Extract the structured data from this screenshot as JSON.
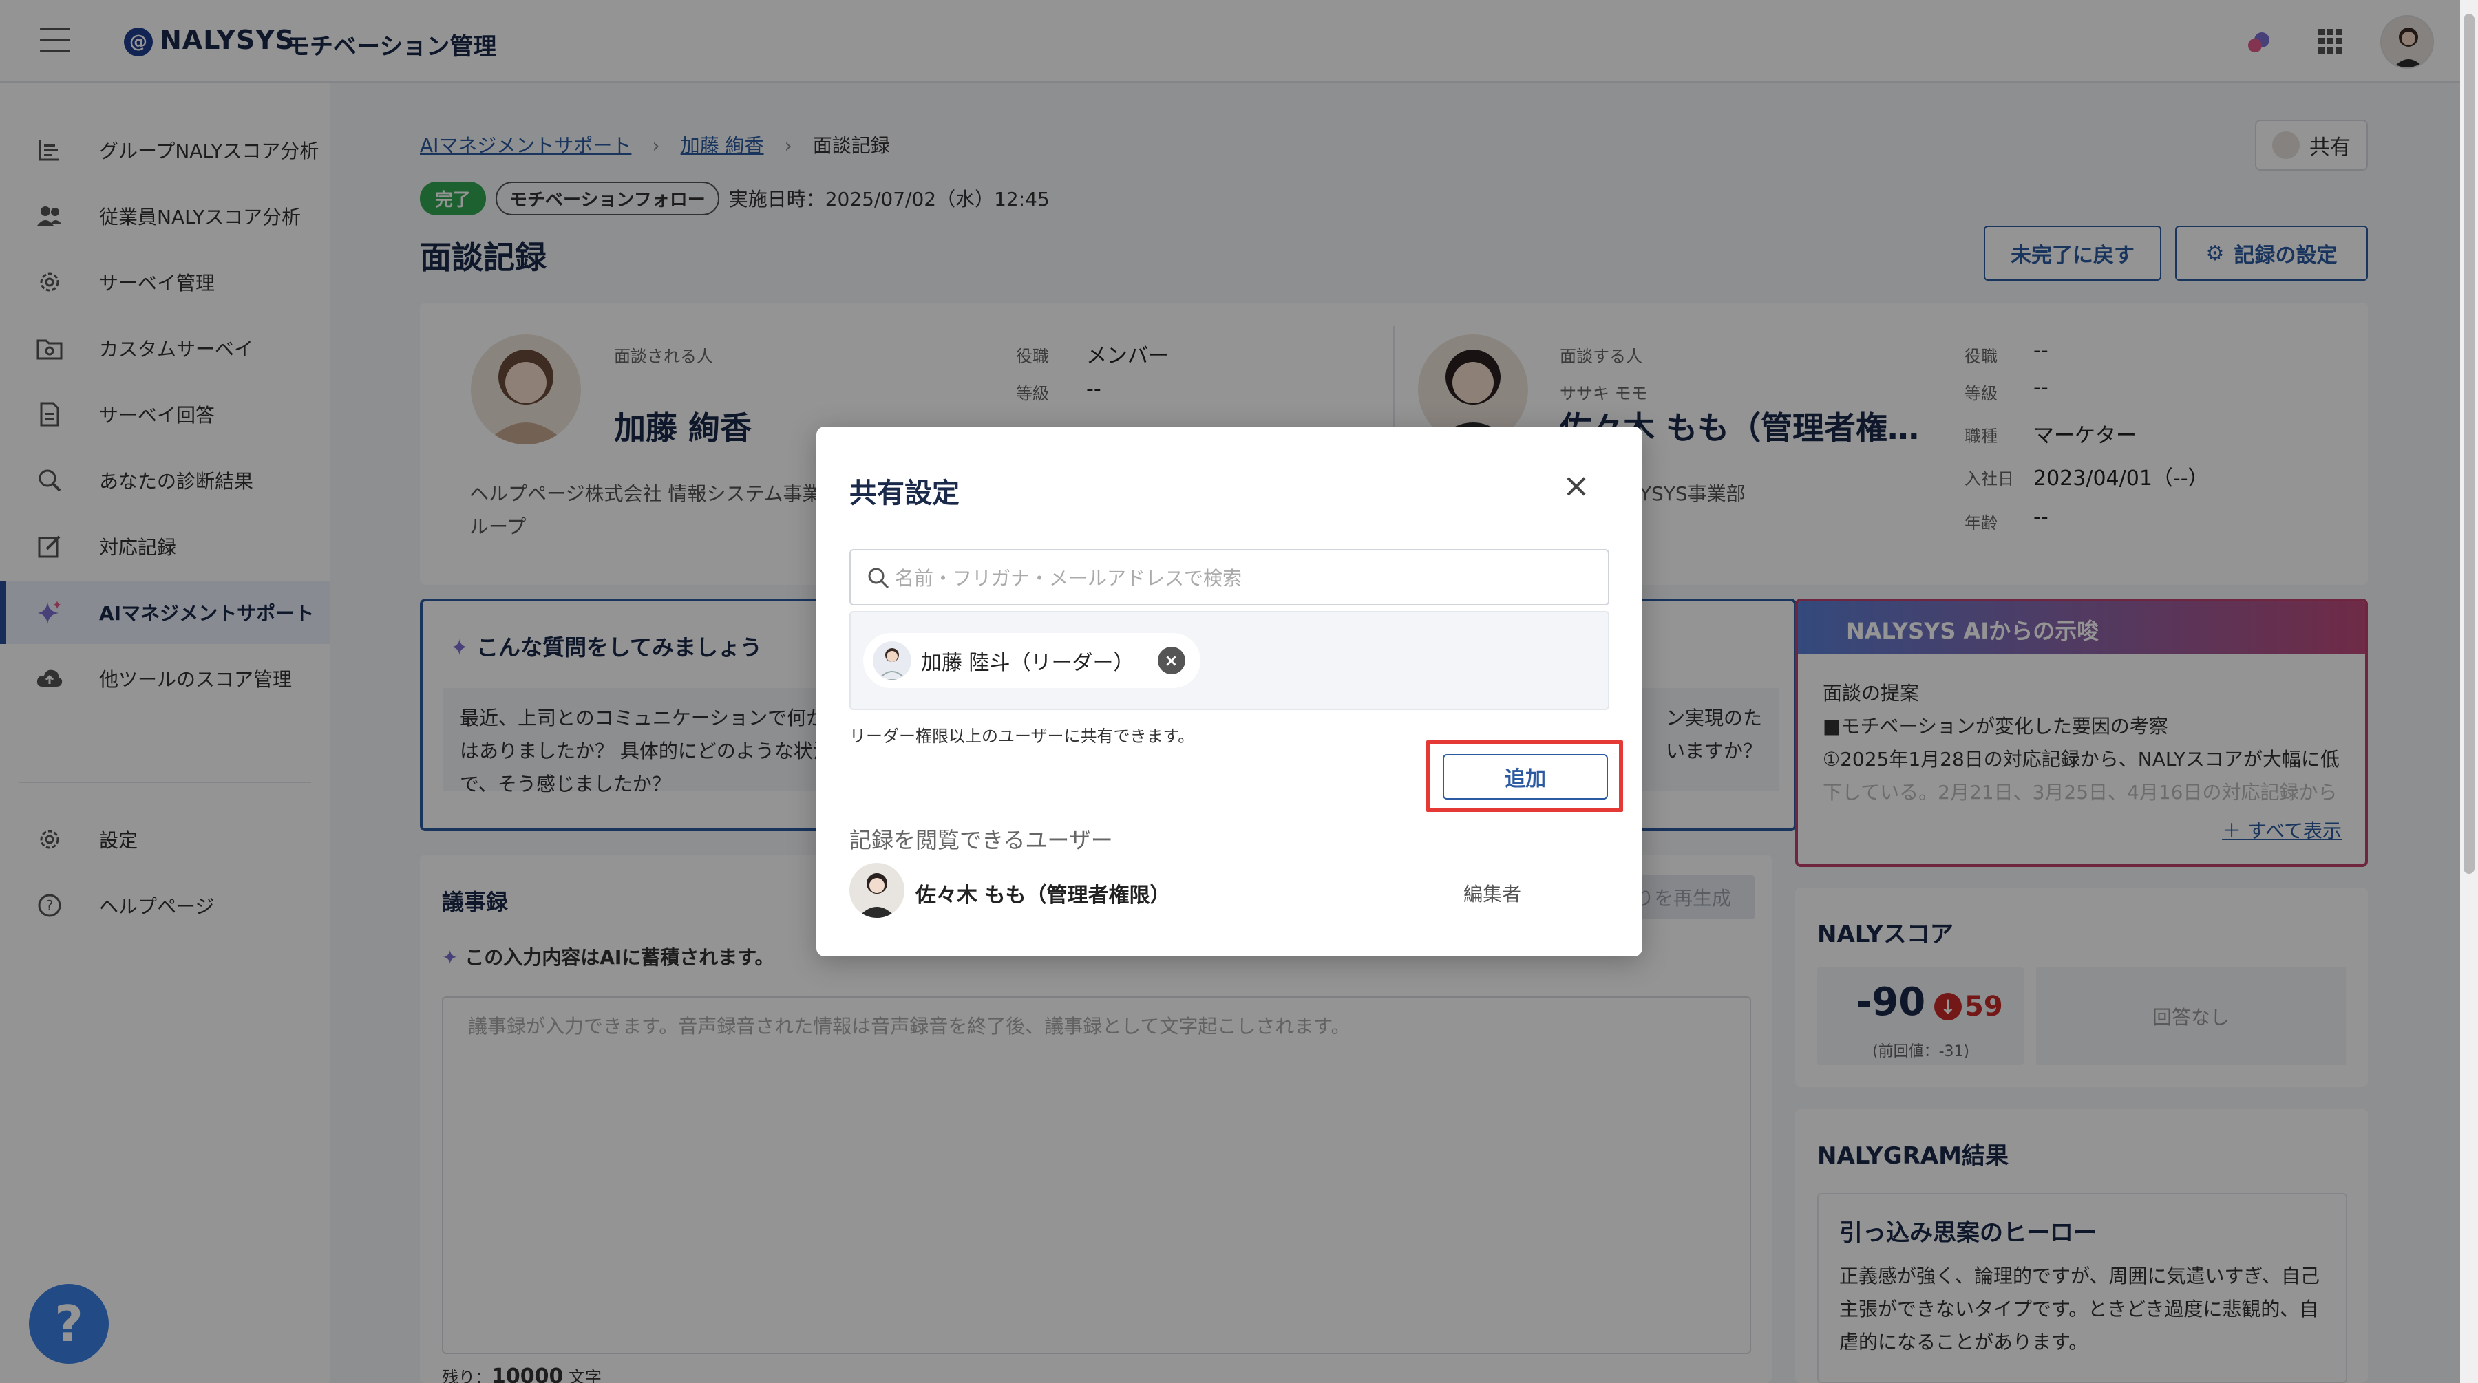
{
  "header": {
    "brand": "NALYSYS",
    "brand_sub": "モチベーション管理"
  },
  "sidebar": {
    "items": [
      {
        "label": "グループNALYスコア分析",
        "icon": "bar-chart-icon"
      },
      {
        "label": "従業員NALYスコア分析",
        "icon": "people-icon"
      },
      {
        "label": "サーベイ管理",
        "icon": "gear-icon"
      },
      {
        "label": "カスタムサーベイ",
        "icon": "folder-gear-icon"
      },
      {
        "label": "サーベイ回答",
        "icon": "document-icon"
      },
      {
        "label": "あなたの診断結果",
        "icon": "magnifier-icon"
      },
      {
        "label": "対応記録",
        "icon": "edit-icon"
      },
      {
        "label": "AIマネジメントサポート",
        "icon": "sparkle-icon"
      },
      {
        "label": "他ツールのスコア管理",
        "icon": "cloud-upload-icon"
      },
      {
        "label": "設定",
        "icon": "gear-icon"
      },
      {
        "label": "ヘルプページ",
        "icon": "question-circle-icon"
      }
    ],
    "help_fab": "?"
  },
  "breadcrumb": {
    "items": [
      "AIマネジメントサポート",
      "加藤 絢香"
    ],
    "current": "面談記録"
  },
  "share_button": "共有",
  "tags": {
    "status": "完了",
    "category": "モチベーションフォロー",
    "date": "実施日時：2025/07/02（水）12:45"
  },
  "page_title": "面談記録",
  "actions": {
    "revert": "未完了に戻す",
    "settings": "記録の設定"
  },
  "interviewee": {
    "label": "面談される人",
    "name": "加藤 絢香",
    "org": "ヘルプページ株式会社 情報システム事業",
    "org2": "ループ",
    "role_label": "役職",
    "role": "メンバー",
    "grade_label": "等級",
    "grade": "--"
  },
  "interviewer": {
    "label": "面談する人",
    "kana": "ササキ モモ",
    "name": "佐々木 もも（管理者権…",
    "org": "LYSYS事業部",
    "role_label": "役職",
    "role": "--",
    "grade_label": "等級",
    "grade": "--",
    "job_label": "職種",
    "job": "マーケター",
    "join_label": "入社日",
    "join": "2023/04/01（--）",
    "age_label": "年齢",
    "age": "--"
  },
  "question_card": {
    "title": "こんな質問をしてみましょう",
    "body_left": "最近、上司とのコミュニケーションで何か",
    "body_left2": "はありましたか？ 具体的にどのような状況",
    "body_left3": "で、そう感じましたか？",
    "body_right": "ン実現のた",
    "body_right2": "いますか？"
  },
  "ai_card": {
    "title": "NALYSYS AIからの示唆",
    "line1": "面談の提案",
    "line2": "■モチベーションが変化した要因の考察",
    "line3": "①2025年1月28日の対応記録から、NALYスコアが大幅に低",
    "line4": "下している。2月21日、3月25日、4月16日の対応記録から",
    "more": "すべて表示"
  },
  "notes": {
    "title": "議事録",
    "regen": "りを再生成",
    "warning": "この入力内容はAIに蓄積されます。",
    "placeholder": "議事録が入力できます。音声録音された情報は音声録音を終了後、議事録として文字起こしされます。",
    "count_prefix": "残り：",
    "count": "10000",
    "count_suffix": "文字"
  },
  "score": {
    "title": "NALYスコア",
    "value": "-90",
    "delta": "59",
    "prev": "(前回値：-31)",
    "empty": "回答なし"
  },
  "nalygram": {
    "title": "NALYGRAM結果",
    "head": "引っ込み思案のヒーロー",
    "line1": "正義感が強く、論理的ですが、周囲に気遣いすぎ、自己",
    "line2": "主張ができないタイプです。ときどき過度に悲観的、自",
    "line3": "虐的になることがあります。"
  },
  "modal": {
    "title": "共有設定",
    "search_placeholder": "名前・フリガナ・メールアドレスで検索",
    "chip_name": "加藤 陸斗（リーダー）",
    "note": "リーダー権限以上のユーザーに共有できます。",
    "add_button": "追加",
    "viewers_label": "記録を閲覧できるユーザー",
    "viewer_name": "佐々木 もも（管理者権限）",
    "viewer_role": "編集者"
  },
  "colors": {
    "primary": "#2c5aa0",
    "done_green": "#34a853",
    "highlight_red": "#e53935",
    "score_red": "#c62828"
  }
}
